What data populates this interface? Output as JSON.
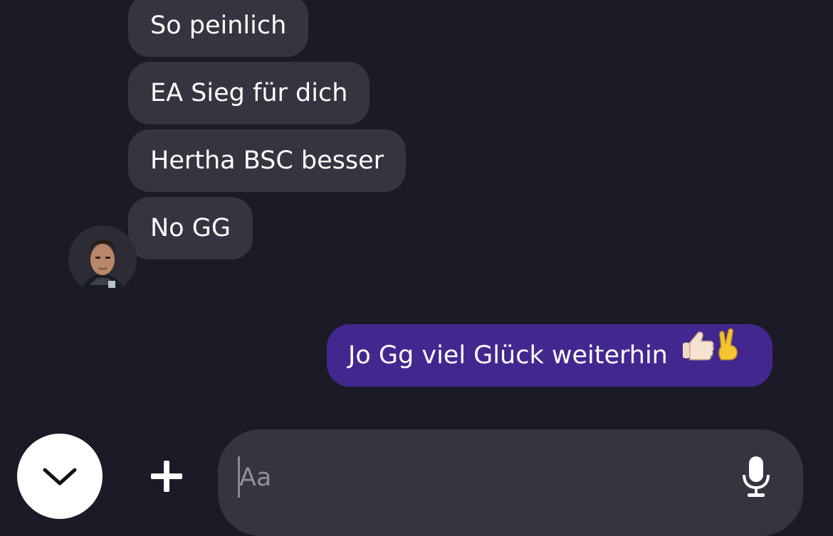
{
  "messages": {
    "incoming": [
      {
        "text": "So peinlich"
      },
      {
        "text": "EA Sieg für dich"
      },
      {
        "text": "Hertha BSC besser"
      },
      {
        "text": "No GG"
      }
    ],
    "outgoing": [
      {
        "text": "Jo Gg viel Glück weiterhin",
        "emoji": "👍🏻✌️"
      }
    ]
  },
  "composer": {
    "placeholder": "Aa",
    "value": ""
  },
  "icons": {
    "scroll_down": "chevron-down-icon",
    "add": "plus-icon",
    "voice": "microphone-icon"
  },
  "colors": {
    "background": "#1b1a26",
    "incoming_bubble": "#35343f",
    "outgoing_bubble": "#42288e",
    "text": "#ffffff"
  }
}
